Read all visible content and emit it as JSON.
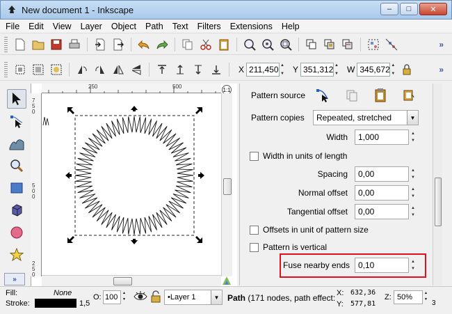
{
  "window": {
    "title": "New document 1 - Inkscape"
  },
  "menu": [
    "File",
    "Edit",
    "View",
    "Layer",
    "Object",
    "Path",
    "Text",
    "Filters",
    "Extensions",
    "Help"
  ],
  "coords": {
    "x_label": "X",
    "x": "211,450",
    "y_label": "Y",
    "y": "351,312",
    "w_label": "W",
    "w": "345,672"
  },
  "rulers": {
    "h1": "250",
    "h2": "500",
    "v": [
      "7",
      "5",
      "0",
      "5",
      "0",
      "0",
      "2",
      "5",
      "0"
    ]
  },
  "zoom_corner": "1:1",
  "panel": {
    "pattern_source_label": "Pattern source",
    "pattern_copies_label": "Pattern copies",
    "pattern_copies_value": "Repeated, stretched",
    "width_label": "Width",
    "width_value": "1,000",
    "width_units_label": "Width in units of length",
    "spacing_label": "Spacing",
    "spacing_value": "0,00",
    "normal_offset_label": "Normal offset",
    "normal_offset_value": "0,00",
    "tangential_offset_label": "Tangential offset",
    "tangential_offset_value": "0,00",
    "offsets_units_label": "Offsets in unit of pattern size",
    "vertical_label": "Pattern is vertical",
    "fuse_label": "Fuse nearby ends",
    "fuse_value": "0,10"
  },
  "status": {
    "fill_label": "Fill:",
    "fill_value": "None",
    "stroke_label": "Stroke:",
    "stroke_width": "1,5",
    "opacity_label": "O:",
    "opacity_value": "100",
    "layer_value": "•Layer 1",
    "message_bold": "Path",
    "message": " (171 nodes, path effect:",
    "cursor_x_label": "X:",
    "cursor_x": "632,36",
    "cursor_y_label": "Y:",
    "cursor_y": "577,81",
    "zoom_label": "Z:",
    "zoom_value": "50%",
    "more": "3"
  },
  "colors": {
    "highlight": "#e0101e",
    "stroke_swatch": "#000000"
  },
  "icons": {
    "more_chevron": "»"
  }
}
